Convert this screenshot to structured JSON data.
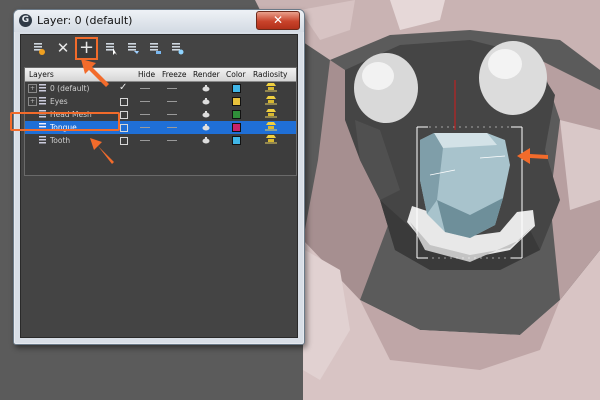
{
  "window": {
    "app_icon": "G",
    "title": "Layer: 0 (default)",
    "close_label": "✕"
  },
  "toolbar": {
    "buttons": [
      {
        "name": "create-layer-icon"
      },
      {
        "name": "delete-layer-icon",
        "label": "✕"
      },
      {
        "name": "add-to-layer-icon",
        "label": "+"
      },
      {
        "name": "select-objects-icon"
      },
      {
        "name": "highlight-layer-icon"
      },
      {
        "name": "hide-all-icon"
      },
      {
        "name": "freeze-all-icon"
      }
    ]
  },
  "layers_table": {
    "columns": [
      "Layers",
      "Hide",
      "Freeze",
      "Render",
      "Color",
      "Radiosity"
    ],
    "rows": [
      {
        "name": "0 (default)",
        "expander": "+",
        "active": true,
        "color": "#3fb6e8"
      },
      {
        "name": "Eyes",
        "expander": "+",
        "active": false,
        "color": "#e8c23c"
      },
      {
        "name": "Head Mesh",
        "expander": "",
        "active": false,
        "color": "#2f8f3a"
      },
      {
        "name": "Tongue",
        "expander": "",
        "active": false,
        "color": "#c7226a",
        "selected": true
      },
      {
        "name": "Tooth",
        "expander": "",
        "active": false,
        "color": "#3fb6e8"
      }
    ]
  },
  "colors": {
    "callout": "#f26b2b",
    "selection": "#1f6fd6"
  }
}
